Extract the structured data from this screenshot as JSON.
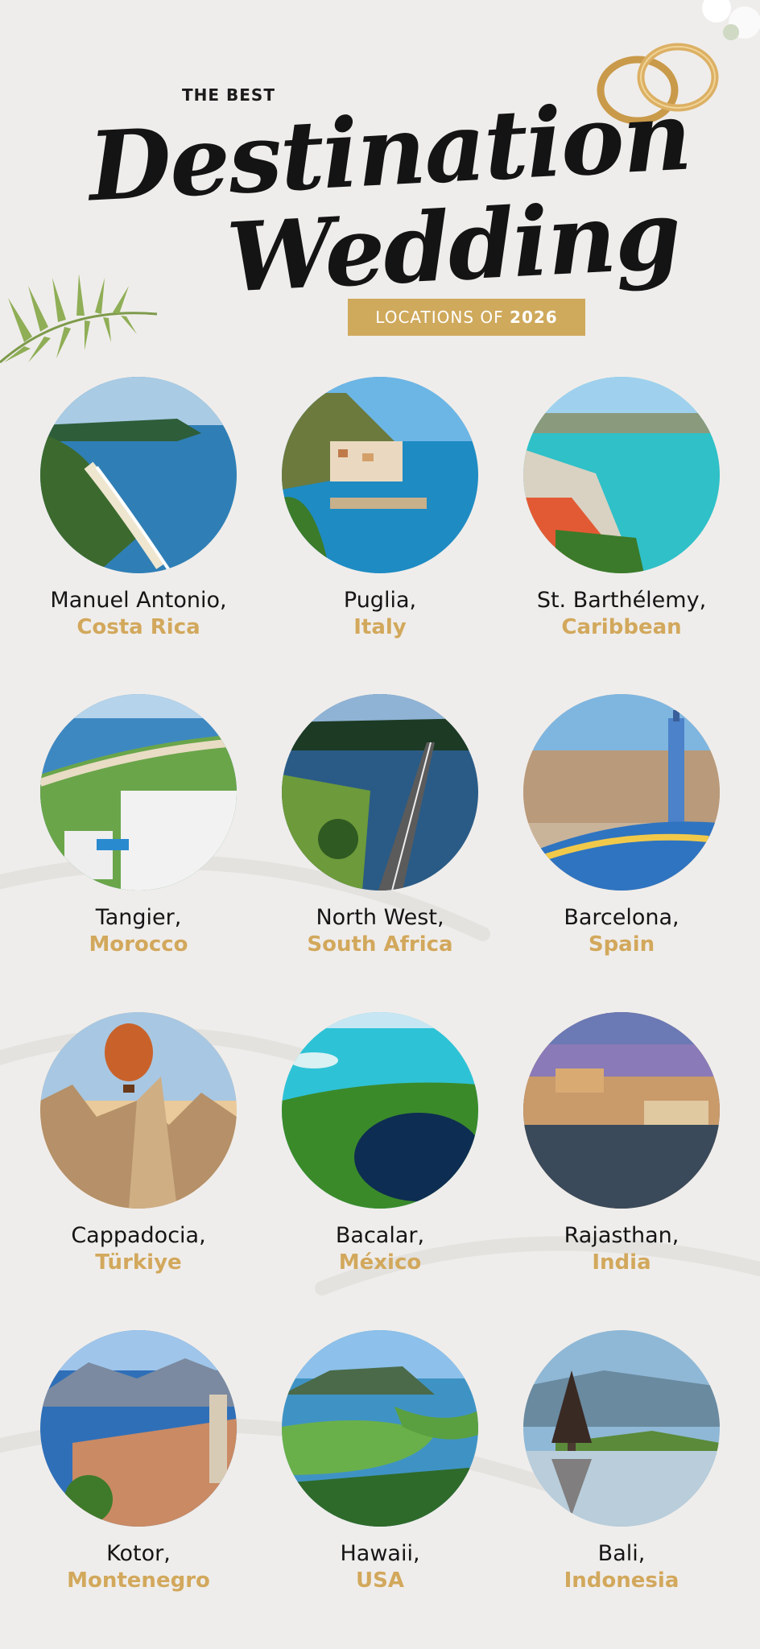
{
  "header": {
    "kicker": "THE BEST",
    "title_line1": "Destination",
    "title_line2": "Wedding",
    "banner_prefix": "LOCATIONS OF",
    "banner_year": "2026"
  },
  "accent_color": "#d2a85c",
  "decorations": [
    "palm-leaf",
    "wedding-rings-icon",
    "flowers"
  ],
  "destinations": [
    {
      "place": "Manuel Antonio,",
      "country": "Costa Rica",
      "photo": "coastal-bay-photo"
    },
    {
      "place": "Puglia,",
      "country": "Italy",
      "photo": "cliffside-village-photo"
    },
    {
      "place": "St. Barthélemy,",
      "country": "Caribbean",
      "photo": "harbor-photo"
    },
    {
      "place": "Tangier,",
      "country": "Morocco",
      "photo": "seaside-city-photo"
    },
    {
      "place": "North West,",
      "country": "South Africa",
      "photo": "bridge-lake-photo"
    },
    {
      "place": "Barcelona,",
      "country": "Spain",
      "photo": "mosaic-park-photo"
    },
    {
      "place": "Cappadocia,",
      "country": "Türkiye",
      "photo": "hot-air-balloon-photo"
    },
    {
      "place": "Bacalar,",
      "country": "México",
      "photo": "lagoon-photo"
    },
    {
      "place": "Rajasthan,",
      "country": "India",
      "photo": "palace-lake-photo"
    },
    {
      "place": "Kotor,",
      "country": "Montenegro",
      "photo": "old-town-bay-photo"
    },
    {
      "place": "Hawaii,",
      "country": "USA",
      "photo": "tropical-island-photo"
    },
    {
      "place": "Bali,",
      "country": "Indonesia",
      "photo": "water-temple-photo"
    }
  ]
}
